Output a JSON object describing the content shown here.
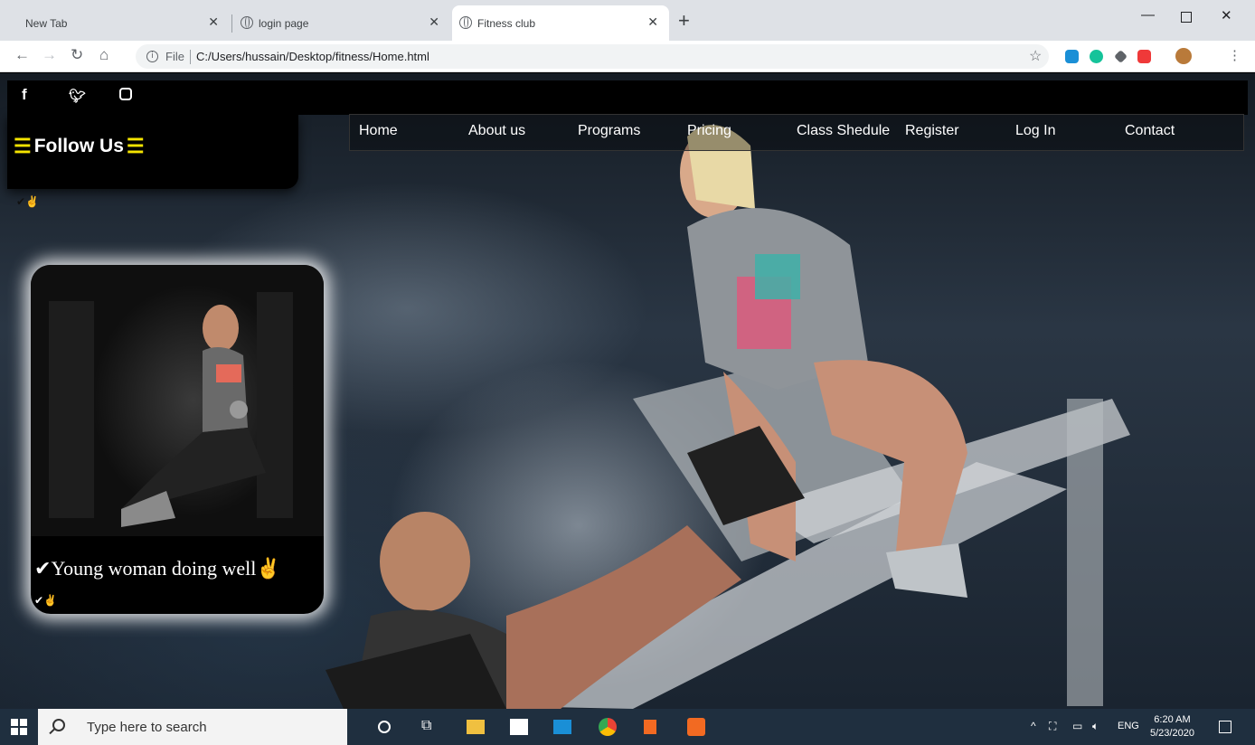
{
  "browser": {
    "tabs": [
      {
        "title": "New Tab",
        "active": false
      },
      {
        "title": "login page",
        "active": false
      },
      {
        "title": "Fitness club",
        "active": true
      }
    ],
    "address": {
      "scheme": "File",
      "url": "C:/Users/hussain/Desktop/fitness/Home.html"
    }
  },
  "page": {
    "social": [
      "f",
      "y",
      "o"
    ],
    "follow_label": "Follow Us",
    "nav": [
      "Home",
      "About us",
      "Programs",
      "Pricing",
      "Class Shedule",
      "Register",
      "Log In",
      "Contact"
    ],
    "card": {
      "caption": "Young woman doing well",
      "check": "✔",
      "hand": "✌"
    }
  },
  "taskbar": {
    "search_placeholder": "Type here to search",
    "lang": "ENG",
    "time": "6:20 AM",
    "date": "5/23/2020"
  },
  "colors": {
    "accent_yellow": "#f5e400",
    "taskbar": "#1f2f3f",
    "tabbar": "#dee1e6"
  }
}
